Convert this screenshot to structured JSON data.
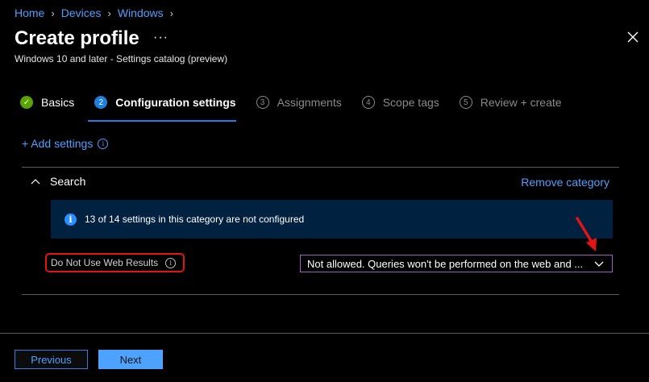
{
  "breadcrumb": {
    "items": [
      "Home",
      "Devices",
      "Windows"
    ]
  },
  "page": {
    "title": "Create profile",
    "more_label": "···",
    "subtitle": "Windows 10 and later - Settings catalog (preview)"
  },
  "steps": [
    {
      "num": "✓",
      "label": "Basics",
      "state": "done"
    },
    {
      "num": "2",
      "label": "Configuration settings",
      "state": "active"
    },
    {
      "num": "3",
      "label": "Assignments",
      "state": "pending"
    },
    {
      "num": "4",
      "label": "Scope tags",
      "state": "pending"
    },
    {
      "num": "5",
      "label": "Review + create",
      "state": "pending"
    }
  ],
  "add_settings": {
    "label": "+ Add settings",
    "info": "i"
  },
  "category": {
    "name": "Search",
    "remove_label": "Remove category",
    "banner_text": "13 of 14 settings in this category are not configured",
    "banner_icon": "i",
    "setting": {
      "label": "Do Not Use Web Results",
      "info": "i",
      "value": "Not allowed. Queries won't be performed on the web and ..."
    }
  },
  "footer": {
    "previous_label": "Previous",
    "next_label": "Next"
  },
  "colors": {
    "accent": "#4aa0ff",
    "active_step": "#1e7fe0",
    "done_step": "#57a300",
    "annotation": "#e31414",
    "banner_bg": "#012141"
  }
}
